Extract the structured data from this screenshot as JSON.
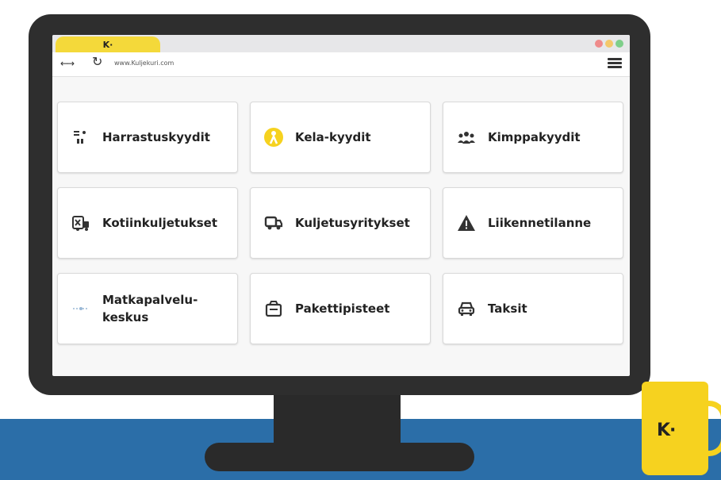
{
  "browser": {
    "tab_logo": "K·",
    "url": "www.Kuljekuri.com"
  },
  "tiles": [
    {
      "label": "Harrastuskyydit",
      "icon": "hobby-icon"
    },
    {
      "label": "Kela-kyydit",
      "icon": "kela-icon"
    },
    {
      "label": "Kimppakyydit",
      "icon": "carpool-icon"
    },
    {
      "label": "Kotiinkuljetukset",
      "icon": "home-delivery-icon"
    },
    {
      "label": "Kuljetusyritykset",
      "icon": "truck-icon"
    },
    {
      "label": "Liikennetilanne",
      "icon": "warning-icon"
    },
    {
      "label_line1": "Matkapalvelu-",
      "label_line2": "keskus",
      "icon": "travel-service-icon"
    },
    {
      "label": "Pakettipisteet",
      "icon": "package-icon"
    },
    {
      "label": "Taksit",
      "icon": "taxi-icon"
    }
  ],
  "mug": {
    "logo": "K·"
  },
  "colors": {
    "accent_yellow": "#f6d21f",
    "desk_blue": "#2b6ea8",
    "monitor": "#2e2e2e"
  }
}
